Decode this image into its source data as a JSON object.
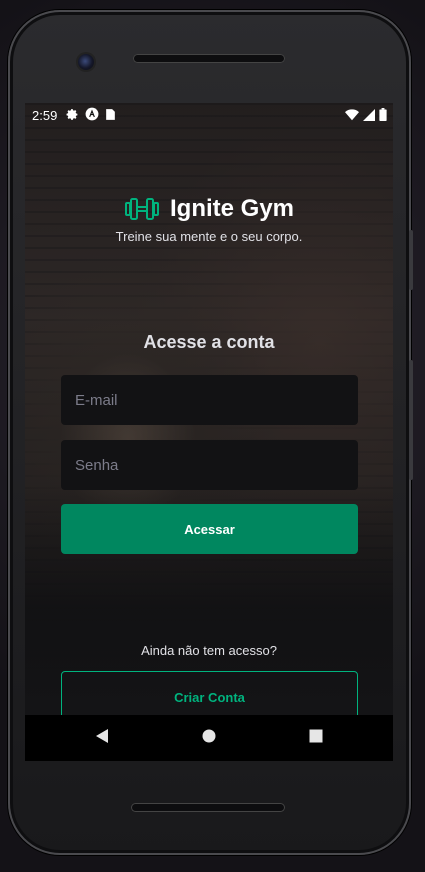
{
  "status_bar": {
    "time": "2:59",
    "left_icons": [
      "gear-icon",
      "app-logo-icon",
      "sim-card-icon"
    ],
    "right_icons": [
      "wifi-icon",
      "cell-signal-icon",
      "battery-icon"
    ]
  },
  "brand": {
    "logo_icon": "dumbbell-icon",
    "name": "Ignite Gym",
    "tagline": "Treine sua mente e o seu corpo."
  },
  "form": {
    "heading": "Acesse a conta",
    "email_placeholder": "E-mail",
    "email_value": "",
    "password_placeholder": "Senha",
    "password_value": "",
    "submit_label": "Acessar"
  },
  "signup": {
    "prompt": "Ainda não tem acesso?",
    "button_label": "Criar Conta"
  },
  "colors": {
    "accent": "#00875f",
    "accent_light": "#00b37e",
    "input_bg": "#121214",
    "text": "#e1e1e6"
  },
  "navigation": {
    "buttons": [
      "back-icon",
      "home-icon",
      "recents-icon"
    ]
  }
}
